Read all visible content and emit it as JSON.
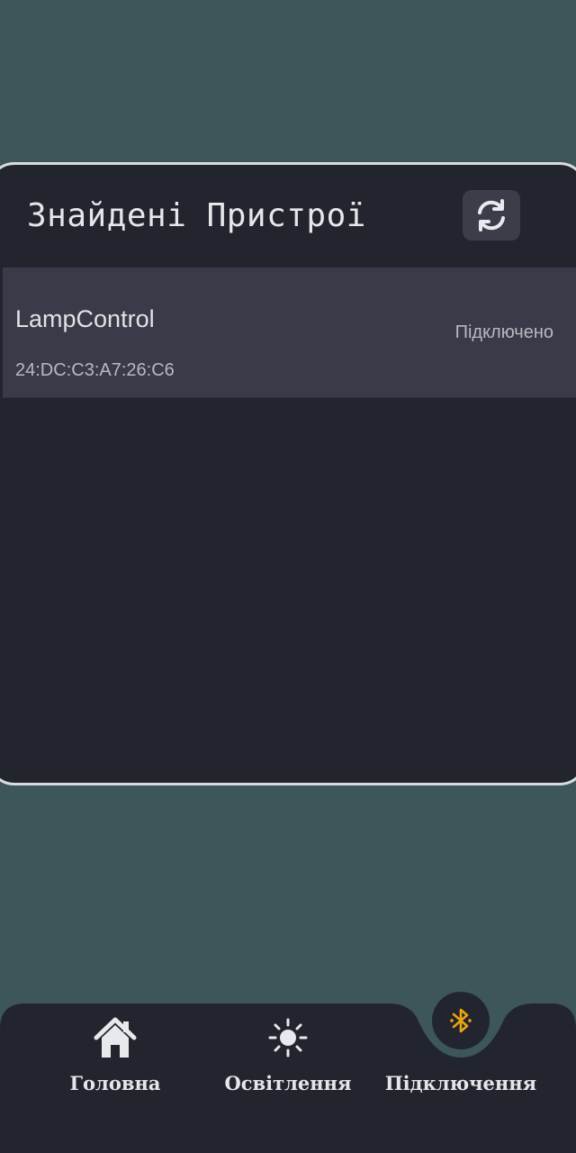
{
  "panel": {
    "title": "Знайдені Пристрої",
    "refresh_icon": "refresh-icon"
  },
  "devices": [
    {
      "name": "LampControl",
      "mac": "24:DC:C3:A7:26:C6",
      "status": "Підключено"
    }
  ],
  "nav": {
    "items": [
      {
        "label": "Головна",
        "icon": "home-icon",
        "active": false
      },
      {
        "label": "Освітлення",
        "icon": "sun-icon",
        "active": false
      },
      {
        "label": "Підключення",
        "icon": "bluetooth-icon",
        "active": true
      }
    ]
  },
  "colors": {
    "background": "#3d5659",
    "panel": "#22252d",
    "row": "#393c48",
    "accent": "#e8a512"
  }
}
